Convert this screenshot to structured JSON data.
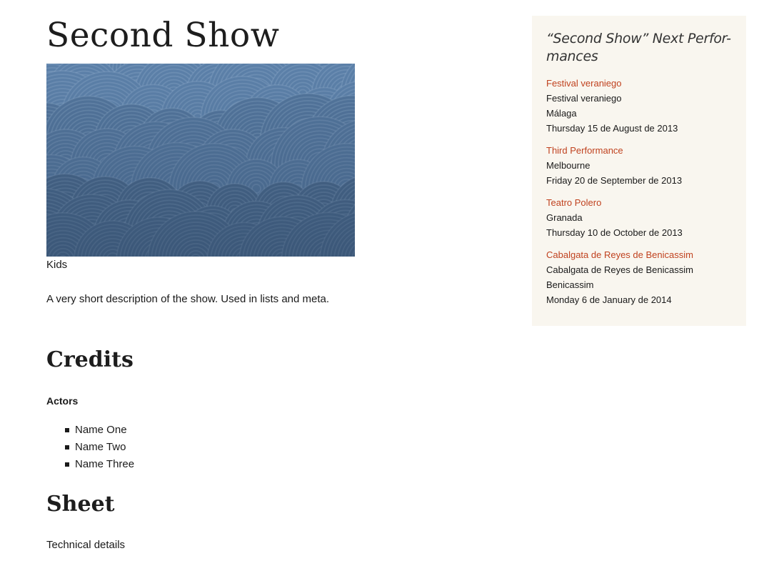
{
  "show": {
    "title": "Second Show",
    "category": "Kids",
    "description": "A very short description of the show. Used in lists and meta.",
    "image_alt": "show poster with blue concentric circle pattern"
  },
  "credits": {
    "heading": "Credits",
    "actors_label": "Actors",
    "actors": [
      "Name One",
      "Name Two",
      "Name Three"
    ]
  },
  "sheet": {
    "heading": "Sheet",
    "text": "Technical details"
  },
  "sidebar": {
    "title": "“Second Show” Next Perfor-mances",
    "title_line1": "“Second Show” Next Perfor-",
    "title_line2": "mances",
    "performances": [
      {
        "name": "Festival veraniego",
        "venue": "Festival veraniego",
        "city": "Málaga",
        "date": "Thursday 15 de August de 2013"
      },
      {
        "name": "Third Performance",
        "venue": "",
        "city": "Melbourne",
        "date": "Friday 20 de September de 2013"
      },
      {
        "name": "Teatro Polero",
        "venue": "",
        "city": "Granada",
        "date": "Thursday 10 de October de 2013"
      },
      {
        "name": "Cabalgata de Reyes de Benicassim",
        "venue": "Cabalgata de Reyes de Benicassim",
        "city": "Benicassim",
        "date": "Monday 6 de January de 2014"
      }
    ]
  },
  "colors": {
    "link": "#c0421f",
    "sidebar_bg": "#f9f6ef",
    "image_top": "#5a7fa8",
    "image_bottom": "#344d6b"
  }
}
